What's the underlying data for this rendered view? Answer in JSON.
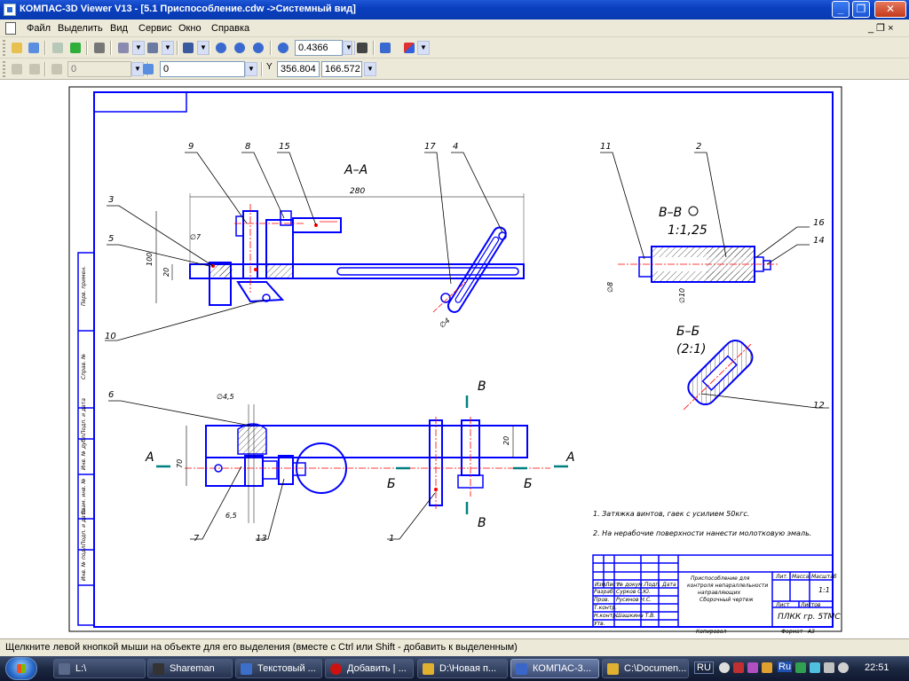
{
  "window": {
    "title": "КОМПАС-3D Viewer V13 - [5.1 Приспособление.cdw ->Системный вид]",
    "minimize": "_",
    "maximize": "❐",
    "close": "✕"
  },
  "menu": {
    "items": [
      "Файл",
      "Выделить",
      "Вид",
      "Сервис",
      "Окно",
      "Справка"
    ],
    "mdi_controls": "_ ❐ ×"
  },
  "toolbar1": {
    "zoom_value": "0.4366"
  },
  "toolbar2": {
    "layer_value": "0",
    "style_value": "0",
    "coord_label": "Y",
    "coord_x": "356.804",
    "coord_y": "166.572"
  },
  "drawing": {
    "section_aa": "А–А",
    "dim_280": "280",
    "dim_100": "100",
    "dim_20_left": "20",
    "dim_fi7": "∅7",
    "dim_fi4": "∅4",
    "section_vv": "В–В",
    "scale_vv": "1:1,25",
    "dim_fi8": "∅8",
    "dim_fi10": "∅10",
    "section_bb": "Б–Б",
    "scale_bb": "(2:1)",
    "dim_fi45": "∅4,5",
    "dim_70": "70",
    "dim_20_right": "20",
    "dim_65": "6,5",
    "mark_a_left": "А",
    "mark_a_right": "А",
    "mark_b_left": "Б",
    "mark_b_right": "Б",
    "mark_v_top": "В",
    "mark_v_bottom": "В",
    "callouts": [
      "9",
      "8",
      "15",
      "17",
      "4",
      "3",
      "5",
      "10",
      "11",
      "2",
      "16",
      "14",
      "12",
      "6",
      "7",
      "13",
      "1"
    ],
    "note1": "1. Затяжка винтов, гаек с усилием 50кгс.",
    "note2": "2. На нерабочие поверхности нанести молотковую эмаль.",
    "tb_title1": "Приспособление для",
    "tb_title2": "контроля непараллельности",
    "tb_title3": "направляющих",
    "tb_title4": "Сборочный чертеж",
    "tb_org": "ПЛКК  гр. 5ТМС",
    "tb_sheet": "1:1",
    "tb_lit": "Лит.",
    "tb_mass": "Масса",
    "tb_scale": "Масштаб",
    "tb_list": "Лист",
    "tb_lists": "Листов",
    "tb_razrab": "Разраб.",
    "tb_prov": "Пров.",
    "tb_tkontr": "Т.контр.",
    "tb_nkontr": "Н.контр.",
    "tb_utv": "Утв.",
    "tb_izm": "Изм.",
    "tb_list2": "Лист",
    "tb_ndok": "№ докум.",
    "tb_podp": "Подп.",
    "tb_data": "Дата",
    "tb_name1": "Сурков С.Ю.",
    "tb_name2": "Русинов Н.С.",
    "tb_name3": "Шашкина Т.В.",
    "tb_kopiroval": "Копировал",
    "tb_format": "Формат",
    "tb_format_val": "А3",
    "side_perv": "Перв. примен.",
    "side_sprav": "Справ. №",
    "side_podp1": "Подп. и дата",
    "side_inv1": "Инв. № дубл.",
    "side_vzam": "Взам. инв. №",
    "side_podp2": "Подп. и дата",
    "side_inv2": "Инв. № подл."
  },
  "status": {
    "text": "Щелкните левой кнопкой мыши на объекте для его выделения (вместе с Ctrl или Shift - добавить к выделенным)"
  },
  "taskbar": {
    "tasks": [
      {
        "label": "L:\\",
        "color": "#5a6a8a"
      },
      {
        "label": "Shareman",
        "color": "#333333"
      },
      {
        "label": "Текстовый ...",
        "color": "#3b6fc9"
      },
      {
        "label": "Добавить | ...",
        "color": "#cc1111"
      },
      {
        "label": "D:\\Новая п...",
        "color": "#e0b030"
      },
      {
        "label": "КОМПАС-3...",
        "color": "#3a66c8"
      },
      {
        "label": "C:\\Documen...",
        "color": "#e0b030"
      }
    ],
    "lang": "RU",
    "tray_ru": "Ru",
    "clock": "22:51"
  },
  "colors": {
    "drawing_blue": "#0000ff",
    "drawing_red": "#ff0000",
    "marker_teal": "#008080",
    "titlebar": "#0a3fbf"
  }
}
